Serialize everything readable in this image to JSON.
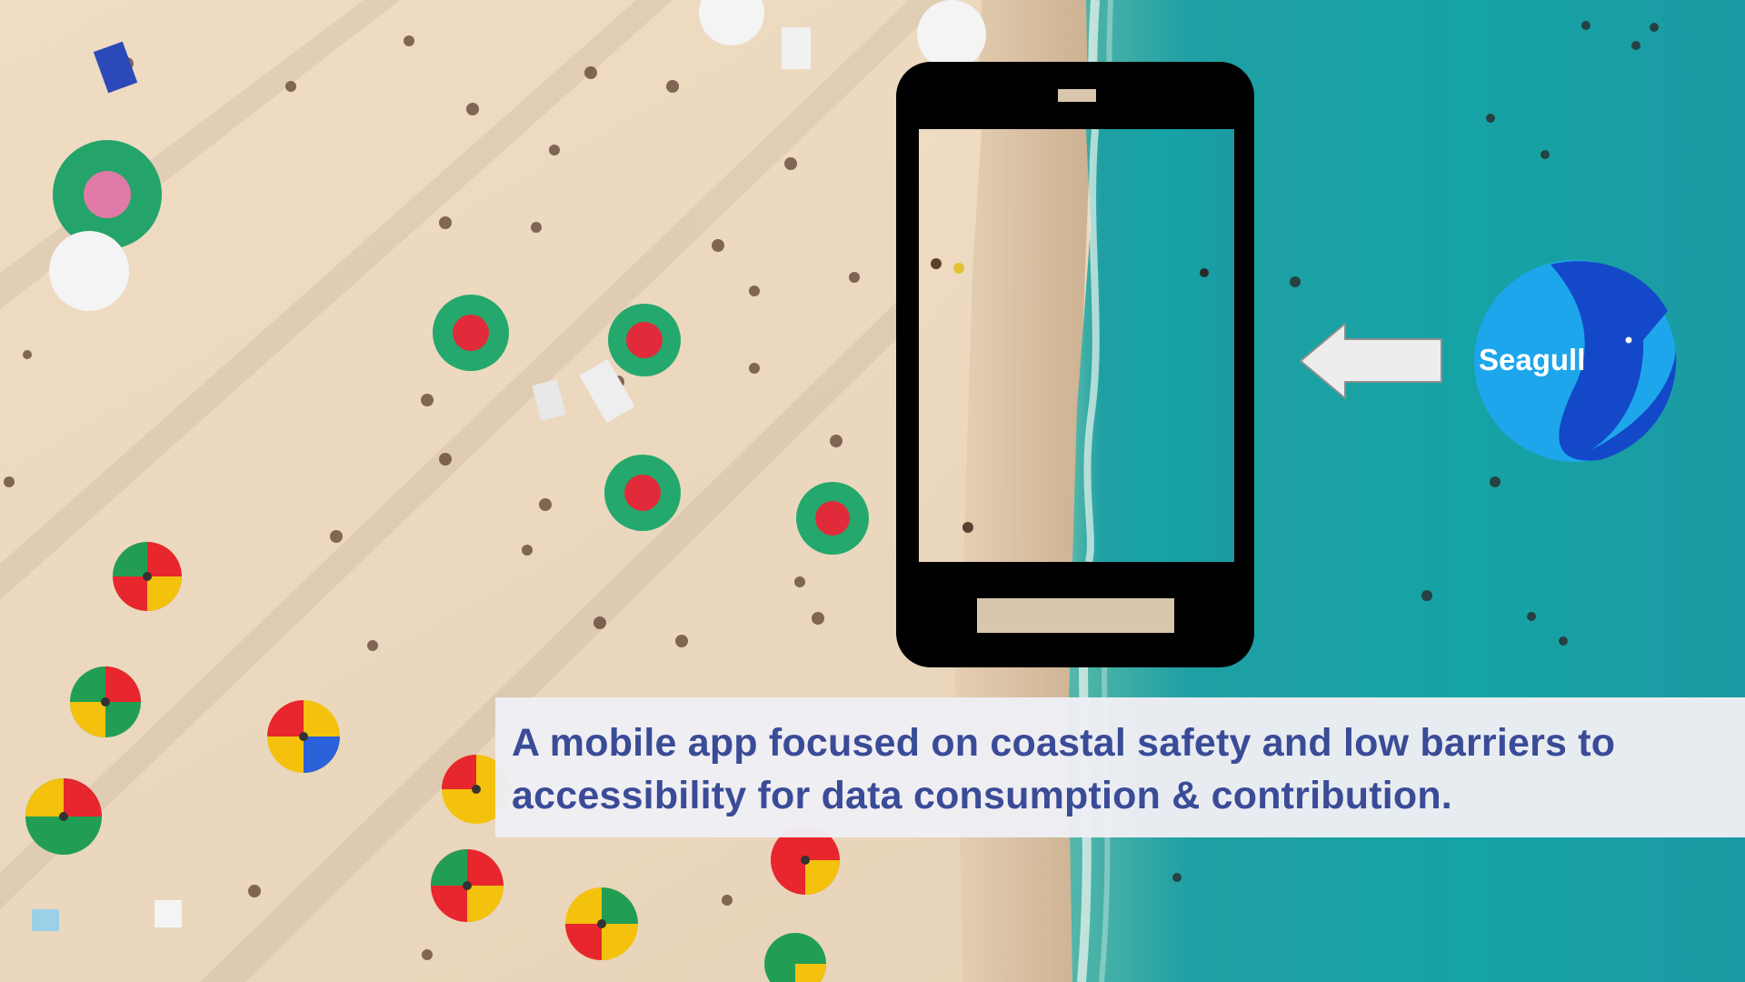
{
  "slide": {
    "caption": "A mobile app focused on coastal safety and low barriers to accessibility for data consumption & contribution."
  },
  "logo": {
    "text": "Seagull",
    "colors": {
      "light": "#1ea6ec",
      "dark": "#1348c9"
    }
  },
  "icons": [
    "smartphone-icon",
    "left-arrow-icon",
    "seagull-logo",
    "beach-umbrella-icon"
  ],
  "colors": {
    "caption_text": "#3a4b97",
    "caption_bg": "#eeeef4",
    "sand": "#ecd9bf",
    "sea": "#1aa3a6",
    "phone": "#000000",
    "arrow": "#ededed"
  }
}
